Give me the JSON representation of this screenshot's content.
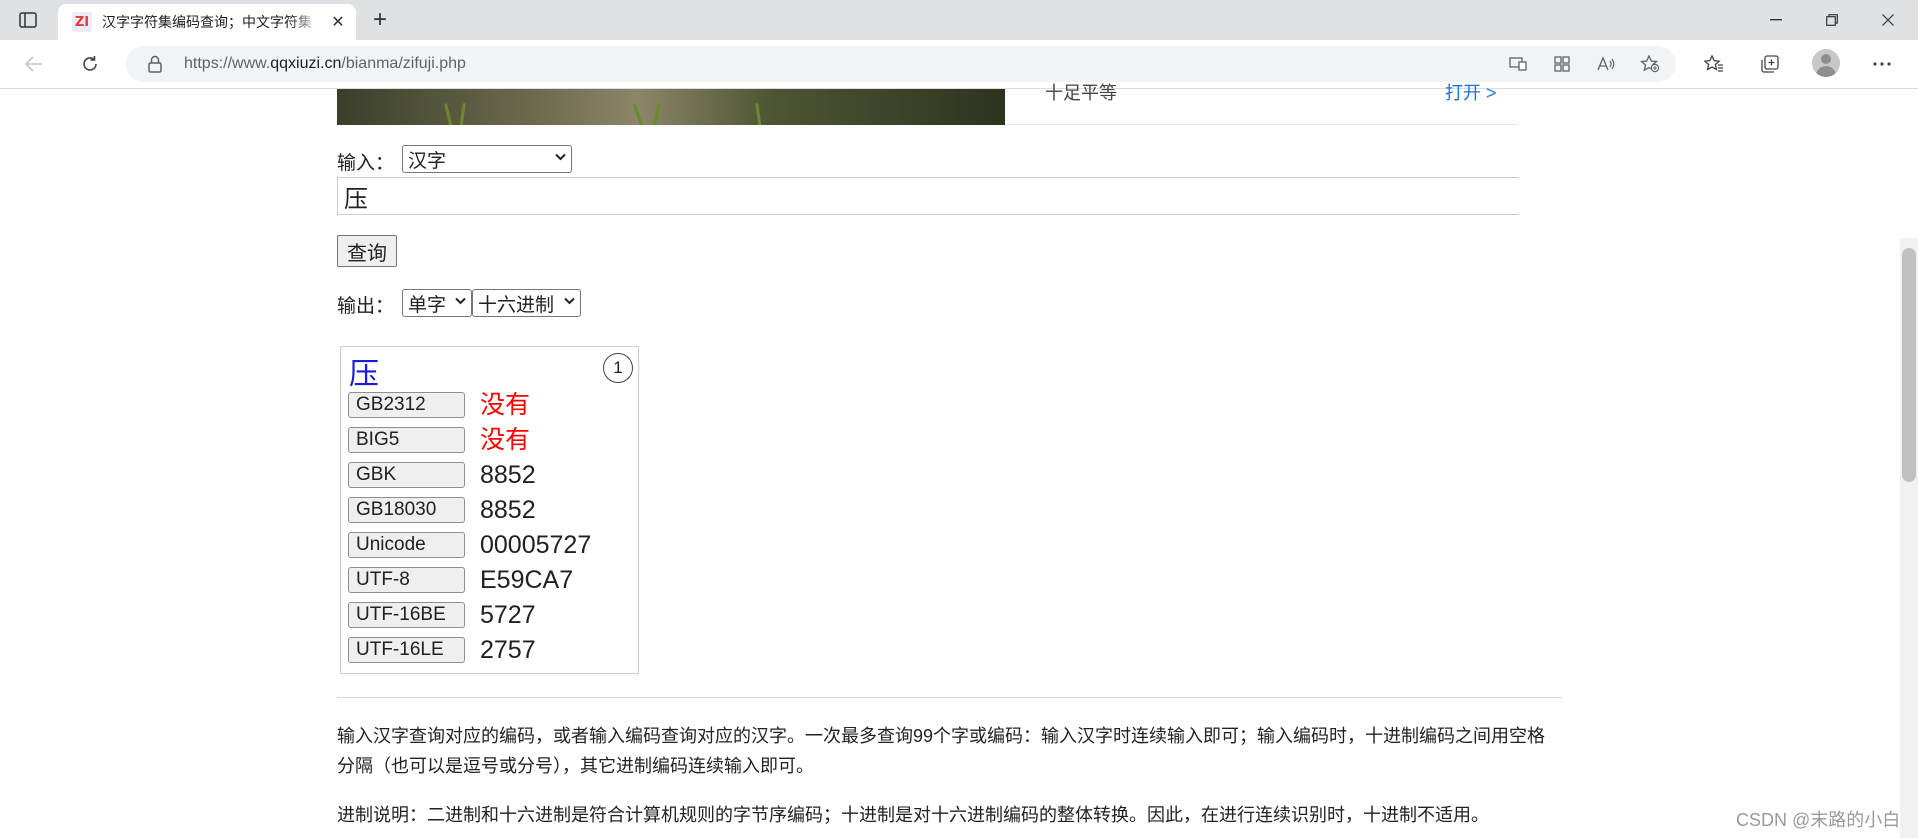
{
  "browser": {
    "tab_title": "汉字字符集编码查询；中文字符集",
    "favicon_text": "ZI",
    "url_prefix": "https://www.",
    "url_host": "qqxiuzi.cn",
    "url_path": "/bianma/zifuji.php"
  },
  "banner": {
    "side_text": "十足平等",
    "link_text": "打开 >"
  },
  "form": {
    "input_label": "输入：",
    "input_type": "汉字",
    "input_value": "压",
    "query_button": "查询",
    "output_label": "输出：",
    "output_mode": "单字",
    "output_base": "十六进制"
  },
  "result": {
    "char": "压",
    "count": "1",
    "codes": [
      {
        "label": "GB2312",
        "value": "没有",
        "missing": true
      },
      {
        "label": "BIG5",
        "value": "没有",
        "missing": true
      },
      {
        "label": "GBK",
        "value": "8852",
        "missing": false
      },
      {
        "label": "GB18030",
        "value": "8852",
        "missing": false
      },
      {
        "label": "Unicode",
        "value": "00005727",
        "missing": false
      },
      {
        "label": "UTF-8",
        "value": "E59CA7",
        "missing": false
      },
      {
        "label": "UTF-16BE",
        "value": "5727",
        "missing": false
      },
      {
        "label": "UTF-16LE",
        "value": "2757",
        "missing": false
      }
    ]
  },
  "description": {
    "para1": "输入汉字查询对应的编码，或者输入编码查询对应的汉字。一次最多查询99个字或编码：输入汉字时连续输入即可；输入编码时，十进制编码之间用空格分隔（也可以是逗号或分号），其它进制编码连续输入即可。",
    "para2": "进制说明：二进制和十六进制是符合计算机规则的字节序编码；十进制是对十六进制编码的整体转换。因此，在进行连续识别时，十进制不适用。"
  },
  "watermark": "CSDN @末路的小白",
  "colors": {
    "result_char": "#1a1adb",
    "missing": "#ff0000",
    "link": "#1a73e8"
  }
}
